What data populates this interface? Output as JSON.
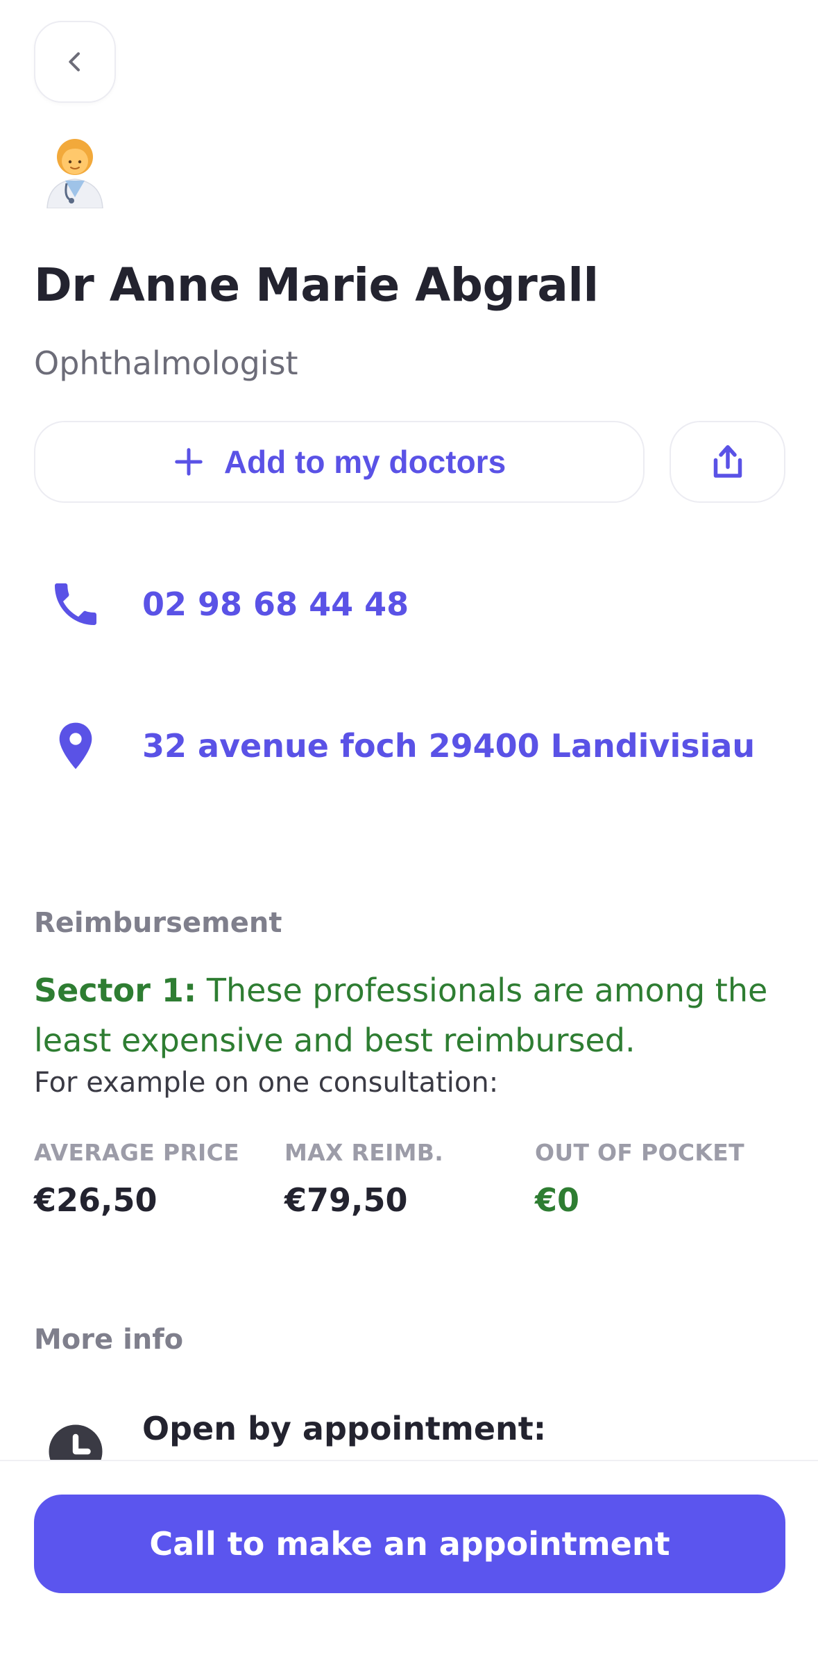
{
  "header": {
    "back_icon": "chevron-left-icon",
    "avatar_icon": "woman-health-worker-emoji"
  },
  "doctor": {
    "name": "Dr Anne Marie Abgrall",
    "specialty": "Ophthalmologist"
  },
  "actions": {
    "add_label": "Add to my doctors",
    "add_icon": "plus-icon",
    "share_icon": "share-icon"
  },
  "contact": {
    "phone": "02 98 68 44 48",
    "phone_icon": "phone-icon",
    "address": "32 avenue foch 29400 Landivisiau",
    "address_icon": "location-pin-icon"
  },
  "reimbursement": {
    "title": "Reimbursement",
    "sector_label": "Sector 1:",
    "sector_desc": " These professionals are among the least expensive and best reimbursed.",
    "example": "For example on one consultation:",
    "columns": [
      {
        "label": "AVERAGE PRICE",
        "value": "€26,50"
      },
      {
        "label": "MAX REIMB.",
        "value": "€79,50"
      },
      {
        "label": "OUT OF POCKET",
        "value": "€0"
      }
    ]
  },
  "more_info": {
    "title": "More info",
    "hours_label": "Open by appointment:",
    "hours_icon": "clock-icon"
  },
  "cta": {
    "label": "Call to make an appointment"
  },
  "colors": {
    "accent": "#5a52e6",
    "cta_bg": "#5b55ee",
    "green": "#2e7d32",
    "text_dark": "#23232f",
    "text_muted": "#6c6c78"
  }
}
